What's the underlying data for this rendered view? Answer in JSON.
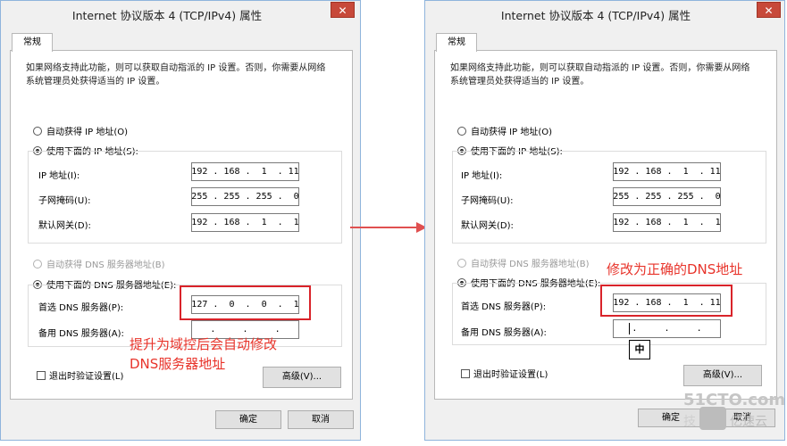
{
  "dialog_title": "Internet 协议版本 4 (TCP/IPv4) 属性",
  "close_glyph": "✕",
  "tab_general": "常规",
  "description": "如果网络支持此功能，则可以获取自动指派的 IP 设置。否则，你需要从网络系统管理员处获得适当的 IP 设置。",
  "auto_ip_label": "自动获得 IP 地址(O)",
  "manual_ip_label": "使用下面的 IP 地址(S):",
  "ip_address_label": "IP 地址(I):",
  "subnet_label": "子网掩码(U):",
  "gateway_label": "默认网关(D):",
  "auto_dns_label": "自动获得 DNS 服务器地址(B)",
  "manual_dns_label": "使用下面的 DNS 服务器地址(E):",
  "preferred_dns_label": "首选 DNS 服务器(P):",
  "alternate_dns_label": "备用 DNS 服务器(A):",
  "validate_label": "退出时验证设置(L)",
  "advanced_button": "高级(V)...",
  "ok_button": "确定",
  "cancel_button": "取消",
  "left": {
    "ip": "192 . 168 .  1  . 11",
    "subnet": "255 . 255 . 255 .  0",
    "gateway": "192 . 168 .  1  .  1",
    "preferred_dns": "127 .  0  .  0  .  1",
    "alternate_dns": "    .     .     .    ",
    "annotation_line1": "提升为域控后会自动修改",
    "annotation_line2": "DNS服务器地址"
  },
  "right": {
    "ip": "192 . 168 .  1  . 11",
    "subnet": "255 . 255 . 255 .  0",
    "gateway": "192 . 168 .  1  .  1",
    "preferred_dns": "192 . 168 .  1  . 11",
    "alternate_dns": "    .     .     .    ",
    "annotation": "修改为正确的DNS地址",
    "ime_indicator": "中"
  },
  "watermark_site": "51CTO.com",
  "watermark_brand": "亿速云",
  "watermark_fragment": "技",
  "colors": {
    "annotation_red": "#e8342b",
    "arrow_red": "#e05050",
    "close_red": "#c7493a"
  }
}
